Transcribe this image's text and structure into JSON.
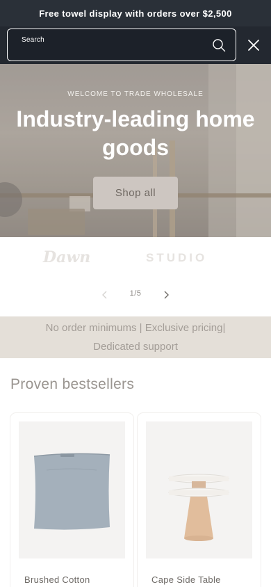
{
  "announcement": {
    "text": "Free towel display with orders over $2,500"
  },
  "search": {
    "label": "Search",
    "icon": "search-icon",
    "close_icon": "close-icon"
  },
  "hero": {
    "kicker": "WELCOME TO TRADE WHOLESALE",
    "title": "Industry-leading home goods",
    "button_label": "Shop all"
  },
  "logos": {
    "items": [
      "Dawn",
      "STUDIO"
    ]
  },
  "slider": {
    "counter": "1/5",
    "prev_icon": "chevron-left-icon",
    "next_icon": "chevron-right-icon"
  },
  "usp": {
    "line1": "No order minimums | Exclusive pricing|",
    "line2": "Dedicated support"
  },
  "bestsellers": {
    "title": "Proven bestsellers",
    "products": [
      {
        "name": "Brushed Cotton"
      },
      {
        "name": "Cape Side Table"
      }
    ]
  },
  "colors": {
    "announcement_bg": "#2a3038",
    "search_bg": "#232830",
    "usp_bg": "#e4dfd8",
    "hero_button_bg": "#cdc6c1"
  }
}
